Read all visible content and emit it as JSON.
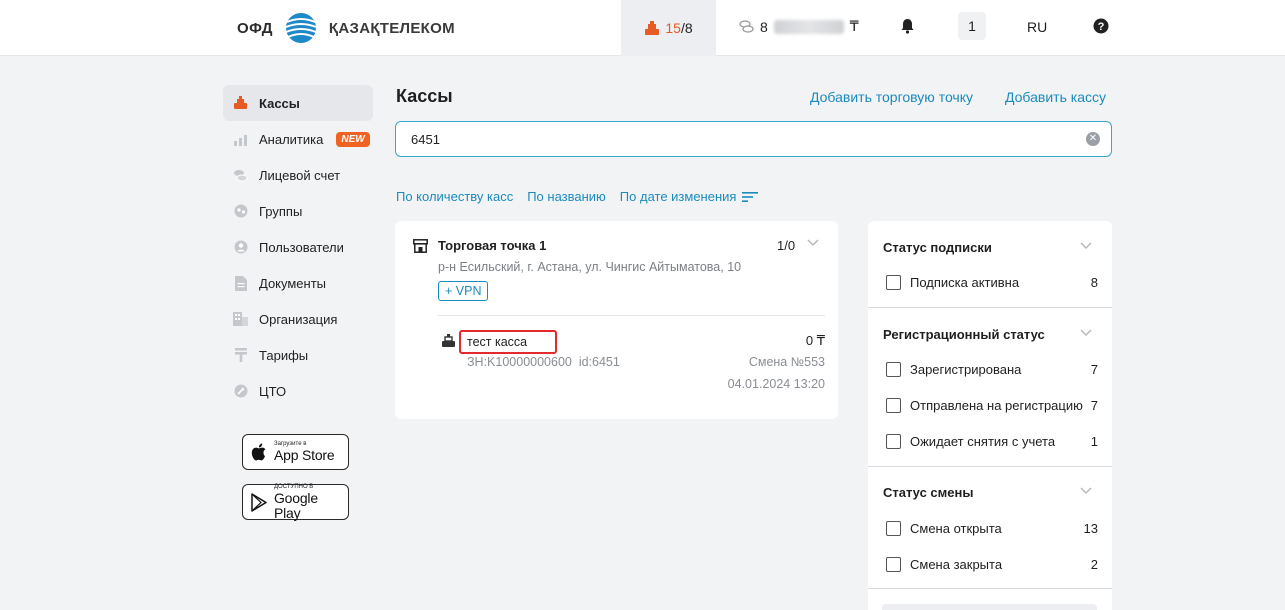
{
  "header": {
    "logo_left": "ОФД",
    "logo_right": "ҚАЗАҚТЕЛЕКОМ",
    "cashbox_active": "15",
    "cashbox_total": "/8",
    "balance_prefix": "8",
    "balance_currency": "₸",
    "notifications_icon": "bell-icon",
    "badge_count": "1",
    "language": "RU",
    "help_icon": "help-icon"
  },
  "sidebar": {
    "items": [
      {
        "label": "Кассы",
        "icon": "cash-register-icon",
        "active": true
      },
      {
        "label": "Аналитика",
        "icon": "analytics-icon",
        "badge": "NEW"
      },
      {
        "label": "Лицевой счет",
        "icon": "coins-icon"
      },
      {
        "label": "Группы",
        "icon": "groups-icon"
      },
      {
        "label": "Пользователи",
        "icon": "user-icon"
      },
      {
        "label": "Документы",
        "icon": "document-icon"
      },
      {
        "label": "Организация",
        "icon": "building-icon"
      },
      {
        "label": "Тарифы",
        "icon": "tariff-icon"
      },
      {
        "label": "ЦТО",
        "icon": "cto-icon"
      }
    ],
    "appstore_small": "Загрузите в",
    "appstore_big": "App Store",
    "googleplay_small": "ДОСТУПНО В",
    "googleplay_big": "Google Play"
  },
  "main": {
    "title": "Кассы",
    "add_point_link": "Добавить торговую точку",
    "add_kassa_link": "Добавить кассу",
    "search_value": "6451",
    "sort": {
      "by_count": "По количеству касс",
      "by_name": "По названию",
      "by_date": "По дате изменения"
    },
    "point": {
      "title": "Торговая точка 1",
      "count": "1/0",
      "address": "р-н Есильский, г. Астана, ул. Чингис Айтыматова, 10",
      "vpn_label": "+ VPN",
      "kassa": {
        "name": "тест касса",
        "sum": "0 ₸",
        "zn": "ЗН:K10000000600",
        "id": "id:6451",
        "smena": "Смена №553",
        "date": "04.01.2024 13:20"
      }
    }
  },
  "filters": {
    "subscription": {
      "title": "Статус подписки",
      "rows": [
        {
          "label": "Подписка активна",
          "count": "8"
        }
      ]
    },
    "registration": {
      "title": "Регистрационный статус",
      "rows": [
        {
          "label": "Зарегистрирована",
          "count": "7"
        },
        {
          "label": "Отправлена на регистрацию",
          "count": "7"
        },
        {
          "label": "Ожидает снятия с учета",
          "count": "1"
        }
      ]
    },
    "shift": {
      "title": "Статус смены",
      "rows": [
        {
          "label": "Смена открыта",
          "count": "13"
        },
        {
          "label": "Смена закрыта",
          "count": "2"
        }
      ]
    }
  },
  "colors": {
    "accent": "#1a8bbd",
    "brand_orange": "#e65a24",
    "highlight_red": "#e32b2b"
  }
}
